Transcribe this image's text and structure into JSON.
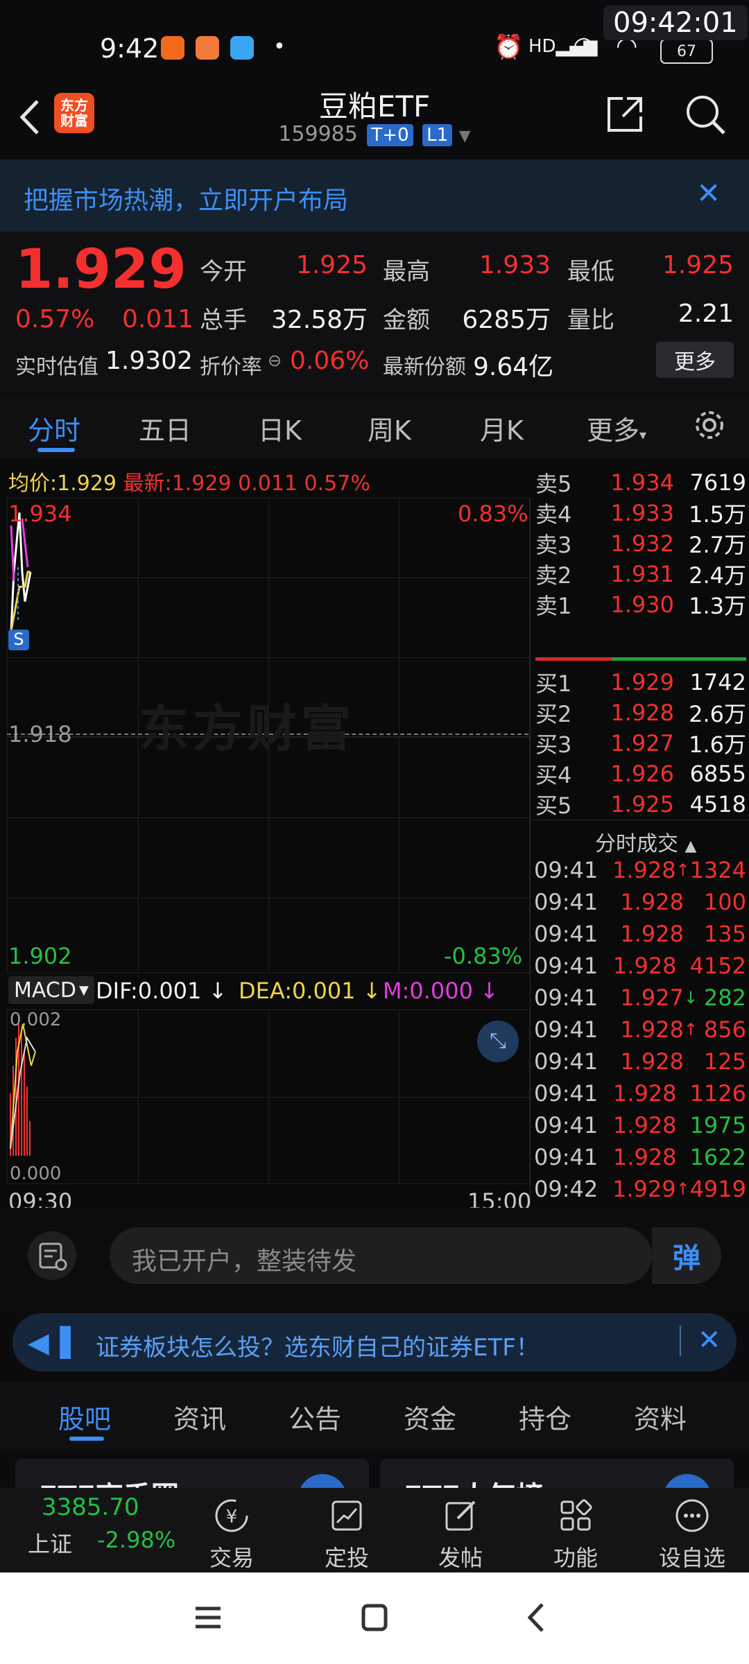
{
  "status_bar": {
    "time": "9:42",
    "clock_overlay": "09:42:01",
    "battery": "67"
  },
  "header": {
    "logo_text": "东方\n财富",
    "title": "豆粕ETF",
    "code": "159985",
    "chips": [
      "T+0",
      "L1"
    ]
  },
  "banner": {
    "text": "把握市场热潮，立即开户布局"
  },
  "quote": {
    "price": "1.929",
    "change_pct": "0.57%",
    "change": "0.011",
    "open_label": "今开",
    "open": "1.925",
    "high_label": "最高",
    "high": "1.933",
    "low_label": "最低",
    "low": "1.925",
    "volume_label": "总手",
    "volume": "32.58万",
    "amount_label": "金额",
    "amount": "6285万",
    "ratio_label": "量比",
    "ratio": "2.21",
    "iopv_label": "实时估值",
    "iopv": "1.9302",
    "premium_label": "折价率",
    "premium": "0.06%",
    "shares_label": "最新份额",
    "shares": "9.64亿",
    "more_button": "更多"
  },
  "chart_tabs": {
    "items": [
      "分时",
      "五日",
      "日K",
      "周K",
      "月K",
      "更多"
    ],
    "active": 0
  },
  "chart_info": {
    "avg_label": "均价:",
    "avg": "1.929",
    "latest_label": "最新:",
    "latest": "1.929",
    "change": "0.011",
    "change_pct": "0.57%"
  },
  "chart_data": {
    "type": "line",
    "y_max_label": "1.934",
    "y_mid_label": "1.918",
    "y_min_label": "1.902",
    "pct_max_label": "0.83%",
    "pct_min_label": "-0.83%",
    "x_start_label": "09:30",
    "x_end_label": "15:00",
    "ylim": [
      1.902,
      1.934
    ],
    "series": [
      {
        "values": [
          1.925,
          1.929,
          1.931,
          1.933,
          1.929,
          1.927,
          1.928,
          1.929
        ]
      },
      {
        "values": [
          1.925,
          1.926,
          1.927,
          1.928,
          1.928,
          1.928,
          1.929,
          1.929
        ]
      }
    ],
    "watermark": "东方财富",
    "marker": "S"
  },
  "macd": {
    "label": "MACD",
    "dif": "DIF:0.001",
    "dea": "DEA:0.001",
    "m": "M:0.000",
    "top_label": "0.002",
    "bottom_label": "0.000"
  },
  "order_book": {
    "asks": [
      {
        "label": "卖5",
        "price": "1.934",
        "vol": "7619"
      },
      {
        "label": "卖4",
        "price": "1.933",
        "vol": "1.5万"
      },
      {
        "label": "卖3",
        "price": "1.932",
        "vol": "2.7万"
      },
      {
        "label": "卖2",
        "price": "1.931",
        "vol": "2.4万"
      },
      {
        "label": "卖1",
        "price": "1.930",
        "vol": "1.3万"
      }
    ],
    "bids": [
      {
        "label": "买1",
        "price": "1.929",
        "vol": "1742"
      },
      {
        "label": "买2",
        "price": "1.928",
        "vol": "2.6万"
      },
      {
        "label": "买3",
        "price": "1.927",
        "vol": "1.6万"
      },
      {
        "label": "买4",
        "price": "1.926",
        "vol": "6855"
      },
      {
        "label": "买5",
        "price": "1.925",
        "vol": "4518"
      }
    ]
  },
  "ticks": {
    "header": "分时成交",
    "rows": [
      {
        "time": "09:41",
        "price": "1.928",
        "arrow": "↑",
        "vol": "1324",
        "dir": "up"
      },
      {
        "time": "09:41",
        "price": "1.928",
        "arrow": "",
        "vol": "100",
        "dir": "up"
      },
      {
        "time": "09:41",
        "price": "1.928",
        "arrow": "",
        "vol": "135",
        "dir": "up"
      },
      {
        "time": "09:41",
        "price": "1.928",
        "arrow": "",
        "vol": "4152",
        "dir": "up"
      },
      {
        "time": "09:41",
        "price": "1.927",
        "arrow": "↓",
        "vol": "282",
        "dir": "down"
      },
      {
        "time": "09:41",
        "price": "1.928",
        "arrow": "↑",
        "vol": "856",
        "dir": "up"
      },
      {
        "time": "09:41",
        "price": "1.928",
        "arrow": "",
        "vol": "125",
        "dir": "up"
      },
      {
        "time": "09:41",
        "price": "1.928",
        "arrow": "",
        "vol": "1126",
        "dir": "up"
      },
      {
        "time": "09:41",
        "price": "1.928",
        "arrow": "",
        "vol": "1975",
        "dir": "down"
      },
      {
        "time": "09:41",
        "price": "1.928",
        "arrow": "",
        "vol": "1622",
        "dir": "down"
      },
      {
        "time": "09:42",
        "price": "1.929",
        "arrow": "↑",
        "vol": "4919",
        "dir": "up"
      }
    ]
  },
  "comment": {
    "placeholder": "我已开户，整装待发",
    "dan_label": "弹"
  },
  "ad": {
    "text": "证券板块怎么投？选东财自己的证券ETF！"
  },
  "sub_tabs": {
    "items": [
      "股吧",
      "资讯",
      "公告",
      "资金",
      "持仓",
      "资料"
    ],
    "active": 0
  },
  "cards": [
    "ETF高手圈",
    "ETF人气榜"
  ],
  "bottom_nav": {
    "index_value": "3385.70",
    "index_name": "上证",
    "index_change": "-2.98%",
    "items": [
      "交易",
      "定投",
      "发帖",
      "功能",
      "设自选"
    ]
  },
  "colors": {
    "up": "#f52f2f",
    "down": "#23c043",
    "accent": "#3d8ef5",
    "avg_line": "#f0d34a"
  }
}
